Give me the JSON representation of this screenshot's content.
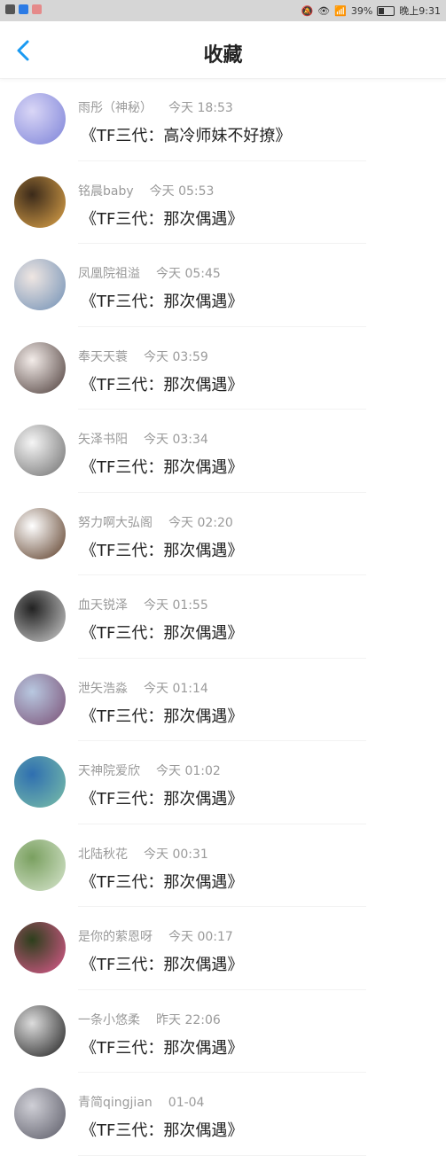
{
  "status_bar": {
    "right_text": "39%",
    "time": "晚上9:31"
  },
  "header": {
    "title": "收藏",
    "accent": "#1a9af2"
  },
  "items": [
    {
      "author": "雨彤（神秘）",
      "time": "今天 18:53",
      "title": "《TF三代：高冷师妹不好撩》",
      "avatar_colors": [
        "#d9d6f6",
        "#7c82d8"
      ]
    },
    {
      "author": "铭晨baby",
      "time": "今天 05:53",
      "title": "《TF三代：那次偶遇》",
      "avatar_colors": [
        "#3b2a1a",
        "#e0a64a"
      ]
    },
    {
      "author": "凤凰院祖溢",
      "time": "今天 05:45",
      "title": "《TF三代：那次偶遇》",
      "avatar_colors": [
        "#efe6e2",
        "#6f8fb5"
      ]
    },
    {
      "author": "奉天天蓑",
      "time": "今天 03:59",
      "title": "《TF三代：那次偶遇》",
      "avatar_colors": [
        "#f3ece9",
        "#4b3b38"
      ]
    },
    {
      "author": "矢泽书阳",
      "time": "今天 03:34",
      "title": "《TF三代：那次偶遇》",
      "avatar_colors": [
        "#f5f5f5",
        "#6e6e6e"
      ]
    },
    {
      "author": "努力啊大弘阁",
      "time": "今天 02:20",
      "title": "《TF三代：那次偶遇》",
      "avatar_colors": [
        "#ffffff",
        "#5a3a24"
      ]
    },
    {
      "author": "血天锐泽",
      "time": "今天 01:55",
      "title": "《TF三代：那次偶遇》",
      "avatar_colors": [
        "#222222",
        "#cfcfcf"
      ]
    },
    {
      "author": "泄矢浩淼",
      "time": "今天 01:14",
      "title": "《TF三代：那次偶遇》",
      "avatar_colors": [
        "#b8c8e0",
        "#7a4f75"
      ]
    },
    {
      "author": "天神院爱欣",
      "time": "今天 01:02",
      "title": "《TF三代：那次偶遇》",
      "avatar_colors": [
        "#2f6fb0",
        "#7bc0a8"
      ]
    },
    {
      "author": "北陆秋花",
      "time": "今天 00:31",
      "title": "《TF三代：那次偶遇》",
      "avatar_colors": [
        "#7aa060",
        "#d8e6cf"
      ]
    },
    {
      "author": "是你的萦恩呀",
      "time": "今天 00:17",
      "title": "《TF三代：那次偶遇》",
      "avatar_colors": [
        "#2d3f1c",
        "#e05a8f"
      ]
    },
    {
      "author": "一条小悠柔",
      "time": "昨天 22:06",
      "title": "《TF三代：那次偶遇》",
      "avatar_colors": [
        "#dcdcdc",
        "#1e1e1e"
      ]
    },
    {
      "author": "青简qingjian",
      "time": "01-04",
      "title": "《TF三代：那次偶遇》",
      "avatar_colors": [
        "#cfcfd6",
        "#5a5a66"
      ]
    }
  ]
}
